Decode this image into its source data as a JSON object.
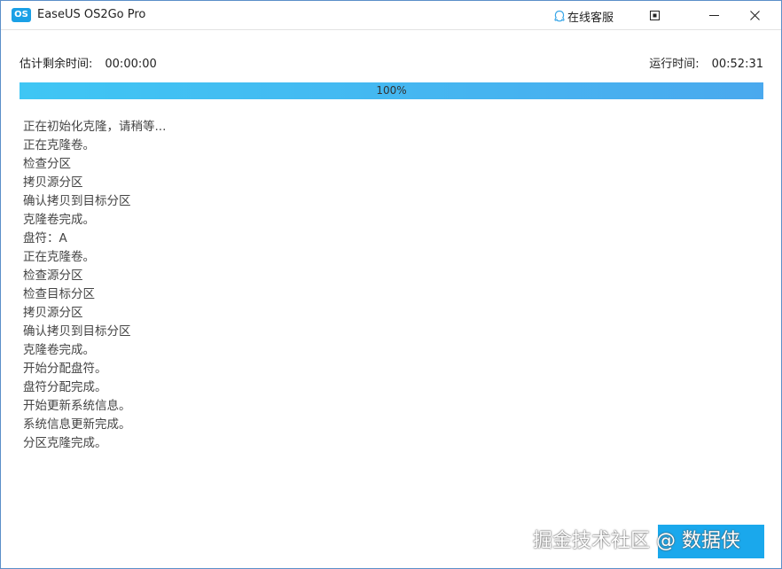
{
  "window": {
    "logo_text": "OS",
    "title": "EaseUS OS2Go Pro",
    "support_label": "在线客服"
  },
  "times": {
    "remaining_label": "估计剩余时间:",
    "remaining_value": "00:00:00",
    "elapsed_label": "运行时间:",
    "elapsed_value": "00:52:31"
  },
  "progress": {
    "percent": 100,
    "label": "100%",
    "colors": {
      "start": "#3fc6f4",
      "end": "#4aa9ee"
    }
  },
  "log": [
    "正在初始化克隆，请稍等...",
    "正在克隆卷。",
    "检查分区",
    "拷贝源分区",
    "确认拷贝到目标分区",
    "克隆卷完成。",
    "盘符：A",
    "正在克隆卷。",
    "检查源分区",
    "检查目标分区",
    "拷贝源分区",
    "确认拷贝到目标分区",
    "克隆卷完成。",
    "开始分配盘符。",
    "盘符分配完成。",
    "开始更新系统信息。",
    "系统信息更新完成。",
    "分区克隆完成。"
  ],
  "watermark": "掘金技术社区 @ 数据侠",
  "icons": {
    "support": "chat-bubble-icon",
    "restore": "restore-icon",
    "minimize": "minimize-icon",
    "close": "close-icon"
  },
  "colors": {
    "accent": "#1aa0e6",
    "window_border": "#5b8fc9"
  }
}
